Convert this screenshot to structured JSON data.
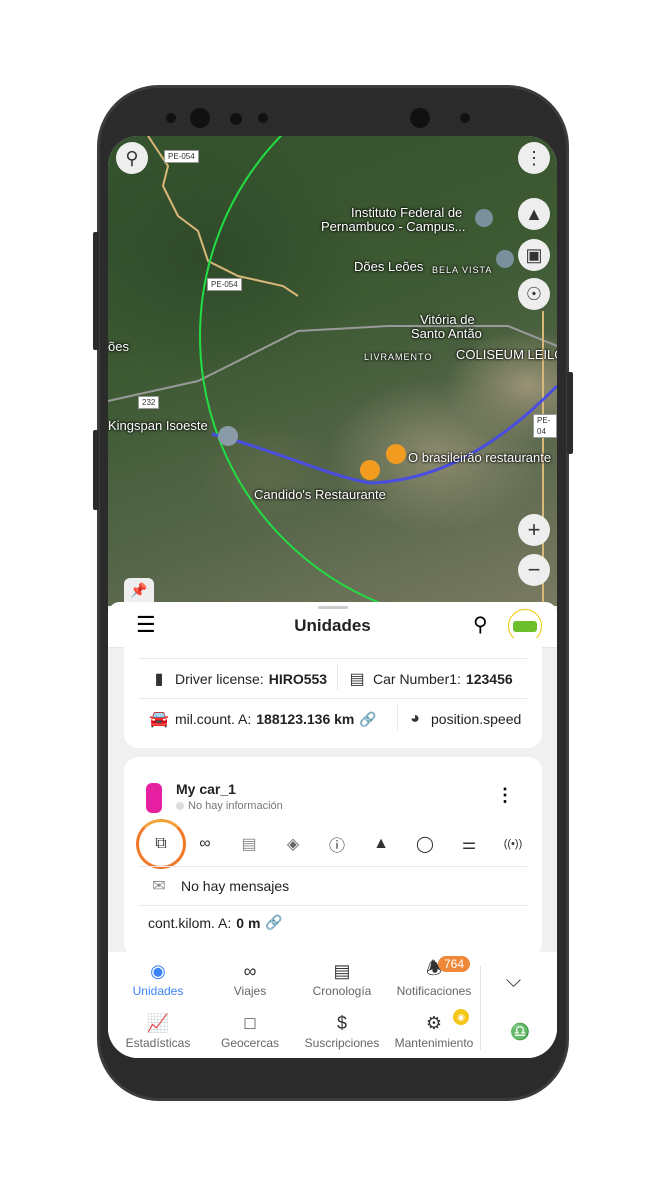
{
  "map": {
    "labels": {
      "road1": "PE-054",
      "road2": "PE-054",
      "road3": "232",
      "road4": "PE-04",
      "inst1": "Instituto Federal de",
      "inst2": "Pernambuco - Campus...",
      "does": "Dões Leões",
      "bela": "BELA VISTA",
      "vit1": "Vitória de",
      "vit2": "Santo Antão",
      "livr": "LIVRAMENTO",
      "coli": "COLISEUM LEILO",
      "oes": "ões",
      "kings": "Kingspan Isoeste",
      "cand": "Candido's Restaurante",
      "bras": "O brasileirão restaurante"
    },
    "route_color": "#4a4ee0",
    "geofence_color": "#22dd44"
  },
  "header": {
    "title": "Unidades"
  },
  "card1": {
    "driver_label": "Driver license: ",
    "driver_value": "HIRO553",
    "car_label": "Car Number1: ",
    "car_value": "123456",
    "mil_label": "mil.count. A: ",
    "mil_value": "188123.136 km",
    "speed_label": "position.speed"
  },
  "card2": {
    "name": "My car_1",
    "status": "No hay información",
    "messages": "No hay mensajes",
    "km_label": "cont.kilom. A: ",
    "km_value": "0 m"
  },
  "nav": {
    "items": [
      {
        "label": "Unidades"
      },
      {
        "label": "Viajes"
      },
      {
        "label": "Cronología"
      },
      {
        "label": "Notificaciones"
      },
      {
        "label": "Estadísticas"
      },
      {
        "label": "Geocercas"
      },
      {
        "label": "Suscripciones"
      },
      {
        "label": "Mantenimiento"
      }
    ],
    "badge": "764",
    "active_color": "#3b82f6",
    "badge_color": "#f0883a"
  }
}
